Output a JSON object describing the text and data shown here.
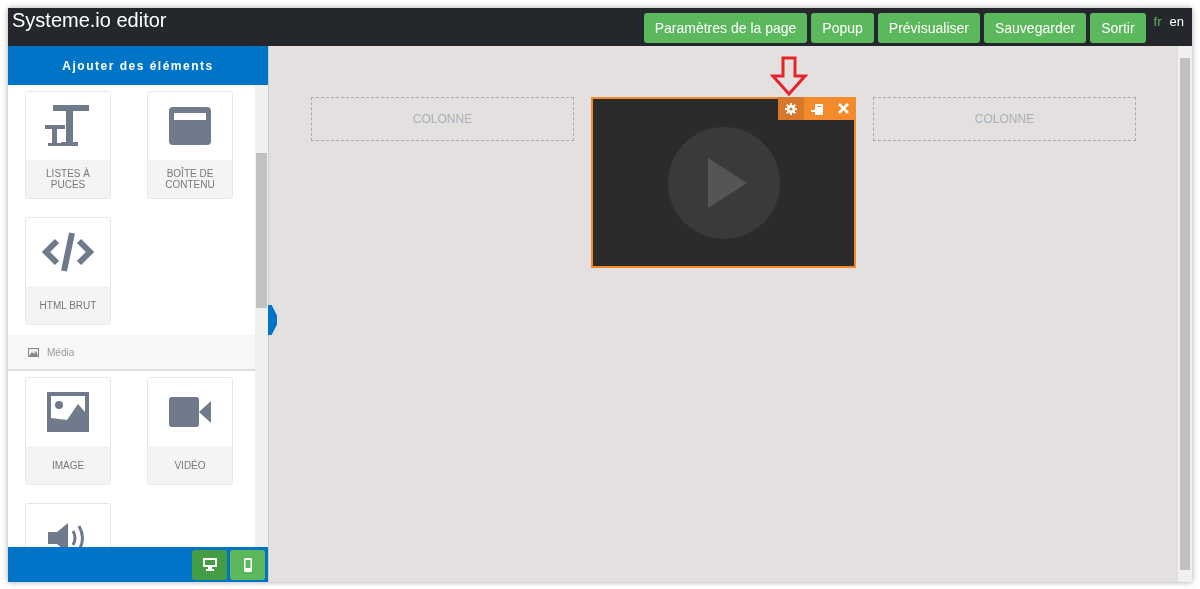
{
  "header": {
    "title": "Systeme.io editor",
    "buttons": [
      "Paramètres de la page",
      "Popup",
      "Prévisualiser",
      "Sauvegarder",
      "Sortir"
    ],
    "languages": [
      {
        "label": "fr",
        "selected": true
      },
      {
        "label": "en",
        "selected": false
      }
    ]
  },
  "sidebar": {
    "title": "Ajouter des éléments",
    "sections": [
      {
        "items": [
          {
            "kind": "text",
            "label": "LISTES À PUCES"
          },
          {
            "kind": "box",
            "label": "BOÎTE DE CONTENU"
          },
          {
            "kind": "code",
            "label": "HTML BRUT"
          }
        ]
      },
      {
        "title": "Média",
        "items": [
          {
            "kind": "image",
            "label": "IMAGE"
          },
          {
            "kind": "video",
            "label": "VIDÉO"
          },
          {
            "kind": "audio"
          }
        ]
      }
    ],
    "devices": [
      {
        "kind": "desktop",
        "selected": true
      },
      {
        "kind": "mobile",
        "selected": false
      }
    ]
  },
  "canvas": {
    "columns": [
      {
        "kind": "empty",
        "label": "COLONNE"
      },
      {
        "kind": "video",
        "selected": true
      },
      {
        "kind": "empty",
        "label": "COLONNE"
      }
    ],
    "toolbar": [
      {
        "kind": "settings",
        "selected": true
      },
      {
        "kind": "copy",
        "selected": false
      },
      {
        "kind": "delete",
        "selected": false
      }
    ]
  }
}
